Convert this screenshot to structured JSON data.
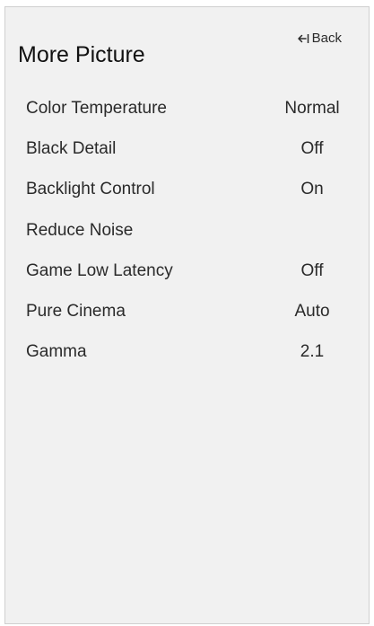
{
  "back_label": "Back",
  "back_icon": "back-arrow-icon",
  "title": "More Picture",
  "menu": [
    {
      "label": "Color Temperature",
      "value": "Normal"
    },
    {
      "label": "Black Detail",
      "value": "Off"
    },
    {
      "label": "Backlight Control",
      "value": "On"
    },
    {
      "label": "Reduce Noise",
      "value": ""
    },
    {
      "label": "Game Low Latency",
      "value": "Off"
    },
    {
      "label": "Pure Cinema",
      "value": "Auto"
    },
    {
      "label": "Gamma",
      "value": "2.1"
    }
  ]
}
